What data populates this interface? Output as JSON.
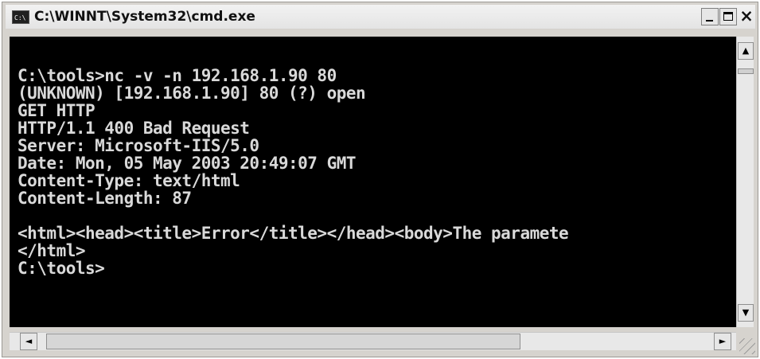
{
  "window": {
    "title": "C:\\WINNT\\System32\\cmd.exe",
    "icon_text": "C:\\",
    "buttons": {
      "minimize_icon": "minimize-icon",
      "maximize_icon": "maximize-icon",
      "close_label": "×"
    }
  },
  "console": {
    "lines": [
      "C:\\tools>nc -v -n 192.168.1.90 80",
      "(UNKNOWN) [192.168.1.90] 80 (?) open",
      "GET HTTP",
      "HTTP/1.1 400 Bad Request",
      "Server: Microsoft-IIS/5.0",
      "Date: Mon, 05 May 2003 20:49:07 GMT",
      "Content-Type: text/html",
      "Content-Length: 87",
      "",
      "<html><head><title>Error</title></head><body>The paramete",
      "</html>",
      "C:\\tools>"
    ],
    "background": "#000000",
    "text_color": "#d9d9d9"
  },
  "scrollbars": {
    "up_arrow": "▲",
    "down_arrow": "▼",
    "left_arrow": "◄",
    "right_arrow": "►"
  }
}
